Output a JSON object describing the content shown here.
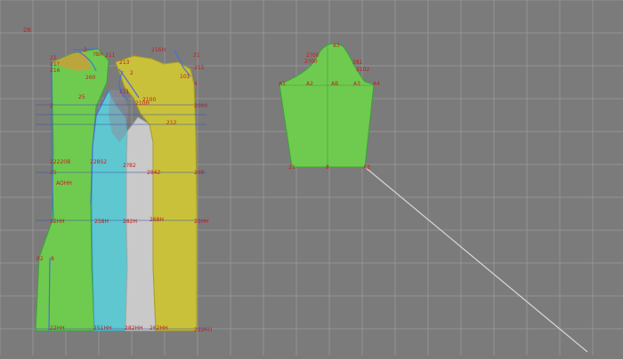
{
  "colors": {
    "background": "#7b7b7b",
    "grid": "#9a9a9a",
    "green_piece": "#6fcb4f",
    "cyan_piece": "#5ec7d0",
    "white_piece": "#c9c9c9",
    "yellow_piece": "#c9c13a",
    "orange_piece": "#c9a03a",
    "label_red": "#c02020",
    "line_blue": "#4a6fd6",
    "guide_white": "#d6d6d6"
  },
  "labels": {
    "corner": "26",
    "left_top_21": "21",
    "left_top_215": "21?",
    "left_top_216": "216",
    "left_top_2": "2",
    "left_top_bh": "?BH",
    "mid_top_211": "211",
    "mid_top_213": "213",
    "mid_top_2": "2",
    "right_top_216h": "216H",
    "right_top_21": "21",
    "right_top_215": "215",
    "right_top_101": "101",
    "right_top_4": "4",
    "mid_upper_260": "260",
    "mid_upper_25": "25",
    "mid_upper_211": "211",
    "mid_c_210h": "210H",
    "mid_c_2100": "2100",
    "mid_c_2000": "2000",
    "mid_c_212": "212",
    "mid_row_22220b": "22220B",
    "mid_row_228s2": "228S2",
    "mid_row_282": "2?82",
    "mid_row_2842": "2842",
    "mid_row_208": "208",
    "left_side_2": "2",
    "left_side_25": "25",
    "left_side_aohh": "AOHH",
    "low_row_22h": "22HH",
    "low_row_258h": "258H",
    "low_row_282h": "282H",
    "low_row_268h": "268H",
    "low_row_22h_right": "22HH",
    "bot_left_82": "82",
    "bot_left_8": "8",
    "bottom_22hh": "22HH",
    "bottom_251h": "251HH",
    "bottom_282h": "282HH",
    "bottom_262h": "262HH",
    "bottom_2220h": "222HH",
    "sleeve_top": "83",
    "sleeve_200": "2?00",
    "sleeve_281": "281",
    "sleeve_2102": "2102",
    "sleeve_2100": "2?00",
    "sleeve_left_a1": "A1",
    "sleeve_mid_a2": "A2",
    "sleeve_center": "AB",
    "sleeve_mid_a3": "A3",
    "sleeve_right_a4": "A4",
    "sleeve_bottom_left": "21",
    "sleeve_bottom_mid": "8",
    "sleeve_bottom_right": "A3"
  }
}
